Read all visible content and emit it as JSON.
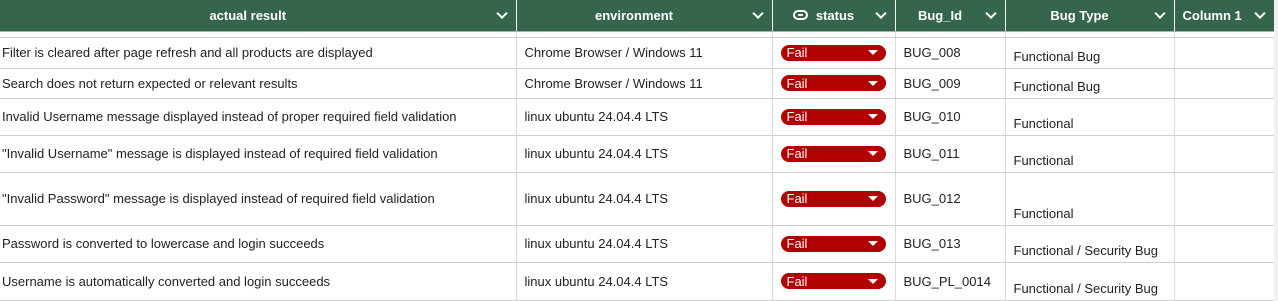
{
  "columns": {
    "actual": "actual result",
    "environment": "environment",
    "status": "status",
    "bug_id": "Bug_Id",
    "bug_type": "Bug Type",
    "column1": "Column 1"
  },
  "rows": [
    {
      "actual": "Filter is cleared after page refresh and all products are displayed",
      "environment": "Chrome Browser / Windows 11",
      "status": "Fail",
      "bug_id": "BUG_008",
      "bug_type": "Functional Bug",
      "column1": ""
    },
    {
      "actual": "Search does not return expected or relevant results",
      "environment": "Chrome Browser / Windows 11",
      "status": "Fail",
      "bug_id": "BUG_009",
      "bug_type": "Functional Bug",
      "column1": ""
    },
    {
      "actual": "Invalid Username message displayed instead of proper required field validation",
      "environment": "linux ubuntu 24.04.4 LTS",
      "status": "Fail",
      "bug_id": "BUG_010",
      "bug_type": "Functional",
      "column1": ""
    },
    {
      "actual": "\"Invalid Username\" message is displayed instead of required field validation",
      "environment": "linux ubuntu 24.04.4 LTS",
      "status": "Fail",
      "bug_id": "BUG_011",
      "bug_type": "Functional",
      "column1": ""
    },
    {
      "actual": "\"Invalid Password\" message is displayed instead of required field validation",
      "environment": "linux ubuntu 24.04.4 LTS",
      "status": "Fail",
      "bug_id": "BUG_012",
      "bug_type": "Functional",
      "column1": ""
    },
    {
      "actual": "Password is converted to lowercase and login succeeds",
      "environment": "linux ubuntu 24.04.4 LTS",
      "status": "Fail",
      "bug_id": "BUG_013",
      "bug_type": "Functional / Security Bug",
      "column1": ""
    },
    {
      "actual": "Username is automatically converted and login succeeds",
      "environment": "linux ubuntu 24.04.4 LTS",
      "status": "Fail",
      "bug_id": "BUG_PL_0014",
      "bug_type": "Functional / Security Bug",
      "column1": ""
    }
  ],
  "colors": {
    "header_bg": "#35654c",
    "fail_pill": "#b10202"
  },
  "icons": {
    "status_header": "chip-icon",
    "header_dropdown": "chevron-down-icon",
    "pill_dropdown": "triangle-down-icon"
  }
}
